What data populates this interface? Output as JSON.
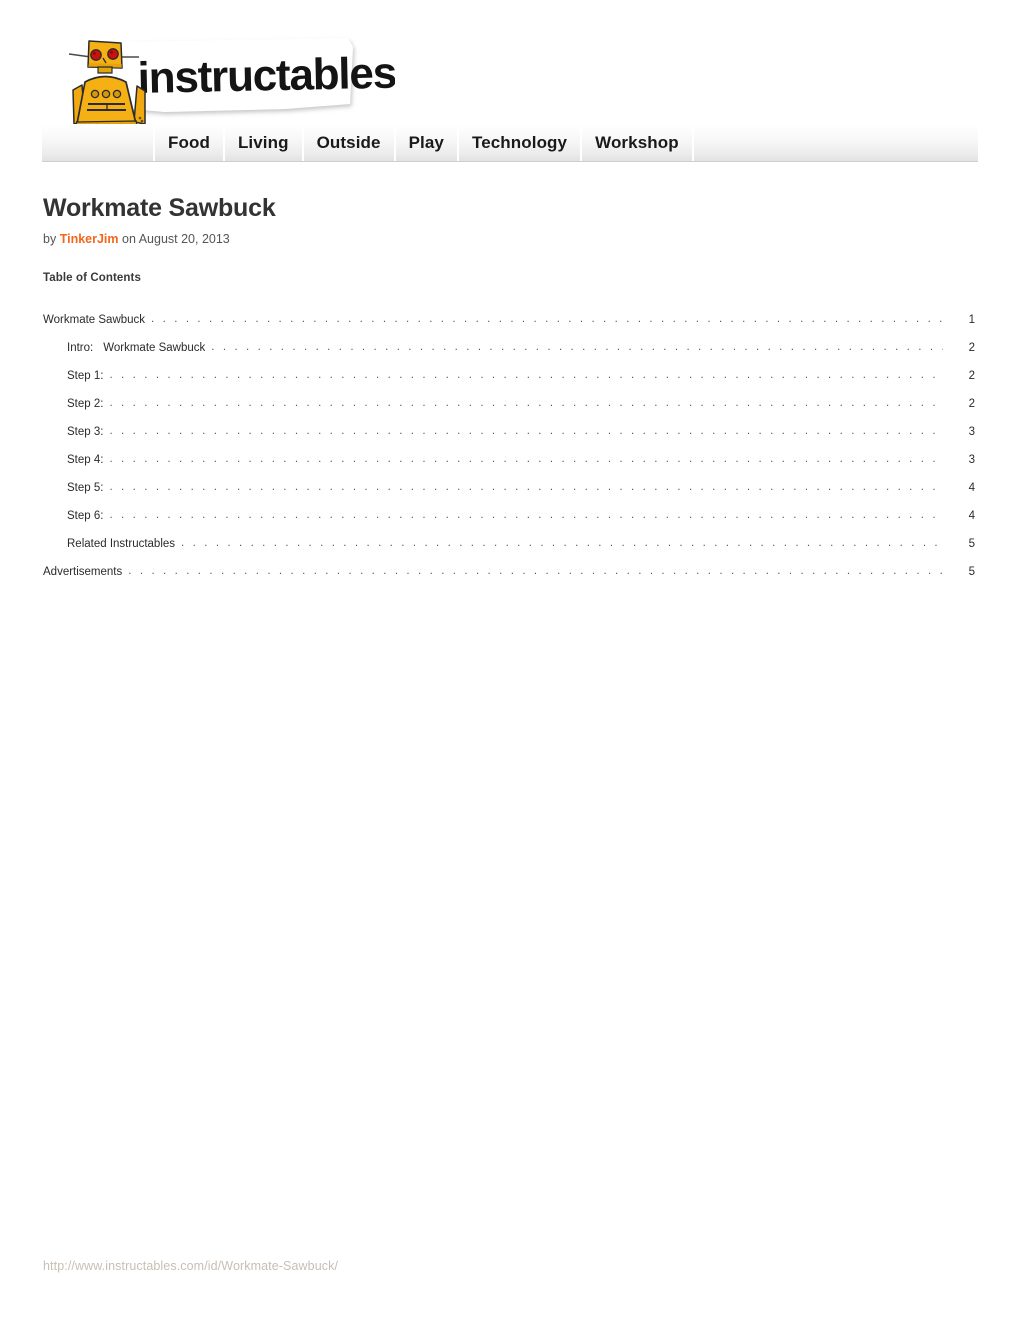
{
  "site": {
    "logo_text": "instructables",
    "logo_mascot": "robot-mascot",
    "colors": {
      "robot_body": "#F5B014",
      "robot_shadow": "#D99A0C",
      "robot_eye": "#CC1111",
      "accent_orange": "#F4661C",
      "nav_text": "#1A1A1A",
      "footer_url": "#C8BFB4",
      "title": "#333333"
    }
  },
  "nav": {
    "items": [
      {
        "label": "Food"
      },
      {
        "label": "Living"
      },
      {
        "label": "Outside"
      },
      {
        "label": "Play"
      },
      {
        "label": "Technology"
      },
      {
        "label": "Workshop"
      }
    ]
  },
  "article": {
    "title": "Workmate Sawbuck",
    "by_prefix": "by",
    "author": "TinkerJim",
    "date_prefix": "on",
    "date": "August 20, 2013"
  },
  "toc": {
    "heading": "Table of Contents",
    "dots": ". . . . . . . . . . . . . . . . . . . . . . . . . . . . . . . . . . . . . . . . . . . . . . . . . . . . . . . . . . . . . . . . . . . . . . . . . . . . . . . . . . . . . . . . . . . . . . . . . . . . . . . . . . . . . . . . . . . . . . . . . . . . . . . . . . . . . . . . . . . . . . . . . . . . . . . . . . . . . . . . . . . . . . . . . . . . . . . . . . . . . . . . . . . . . . . . . . . . . . . . . . .",
    "entries": [
      {
        "level": 1,
        "label": "Workmate Sawbuck",
        "sublabel": "",
        "page": "1"
      },
      {
        "level": 2,
        "label": "Intro:",
        "sublabel": "Workmate Sawbuck",
        "page": "2"
      },
      {
        "level": 2,
        "label": "Step 1:",
        "sublabel": "",
        "page": "2"
      },
      {
        "level": 2,
        "label": "Step 2:",
        "sublabel": "",
        "page": "2"
      },
      {
        "level": 2,
        "label": "Step 3:",
        "sublabel": "",
        "page": "3"
      },
      {
        "level": 2,
        "label": "Step 4:",
        "sublabel": "",
        "page": "3"
      },
      {
        "level": 2,
        "label": "Step 5:",
        "sublabel": "",
        "page": "4"
      },
      {
        "level": 2,
        "label": "Step 6:",
        "sublabel": "",
        "page": "4"
      },
      {
        "level": 2,
        "label": "Related Instructables",
        "sublabel": "",
        "page": "5"
      },
      {
        "level": 1,
        "label": "Advertisements",
        "sublabel": "",
        "page": "5"
      }
    ]
  },
  "footer": {
    "url": "http://www.instructables.com/id/Workmate-Sawbuck/"
  }
}
